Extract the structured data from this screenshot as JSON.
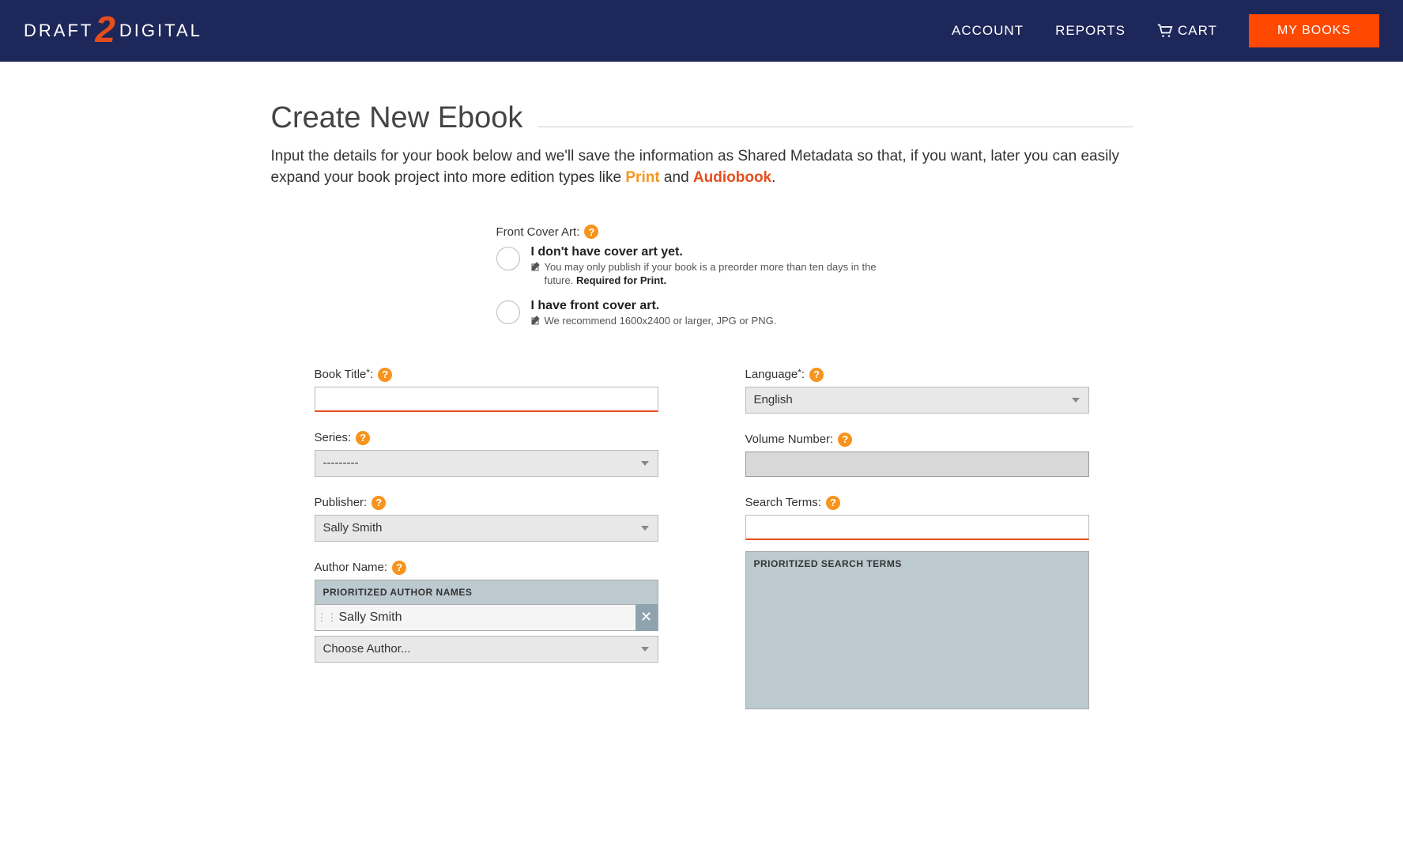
{
  "header": {
    "logo_left": "DRAFT",
    "logo_right": "DIGITAL",
    "nav": {
      "account": "ACCOUNT",
      "reports": "REPORTS",
      "cart": "CART",
      "my_books": "MY BOOKS"
    }
  },
  "page": {
    "title": "Create New Ebook",
    "subtitle_pre": "Input the details for your book below and we'll save the information as Shared Metadata so that, if you want, later you can easily expand your book project into more edition types like ",
    "subtitle_print": "Print",
    "subtitle_and": " and ",
    "subtitle_audio": "Audiobook",
    "subtitle_period": "."
  },
  "cover": {
    "label": "Front Cover Art:",
    "opt1_title": "I don't have cover art yet.",
    "opt1_note": "You may only publish if your book is a preorder more than ten days in the future. ",
    "opt1_strong": "Required for Print.",
    "opt2_title": "I have front cover art.",
    "opt2_note": "We recommend 1600x2400 or larger, JPG or PNG."
  },
  "form": {
    "book_title": {
      "label": "Book Title",
      "value": ""
    },
    "series": {
      "label": "Series:",
      "selected": "---------"
    },
    "publisher": {
      "label": "Publisher:",
      "selected": "Sally Smith"
    },
    "author": {
      "label": "Author Name:",
      "priority_header": "PRIORITIZED AUTHOR NAMES",
      "items": [
        "Sally Smith"
      ],
      "choose": "Choose Author..."
    },
    "language": {
      "label": "Language",
      "selected": "English"
    },
    "volume": {
      "label": "Volume Number:",
      "value": ""
    },
    "search_terms": {
      "label": "Search Terms:",
      "value": "",
      "priority_header": "PRIORITIZED SEARCH TERMS"
    }
  }
}
